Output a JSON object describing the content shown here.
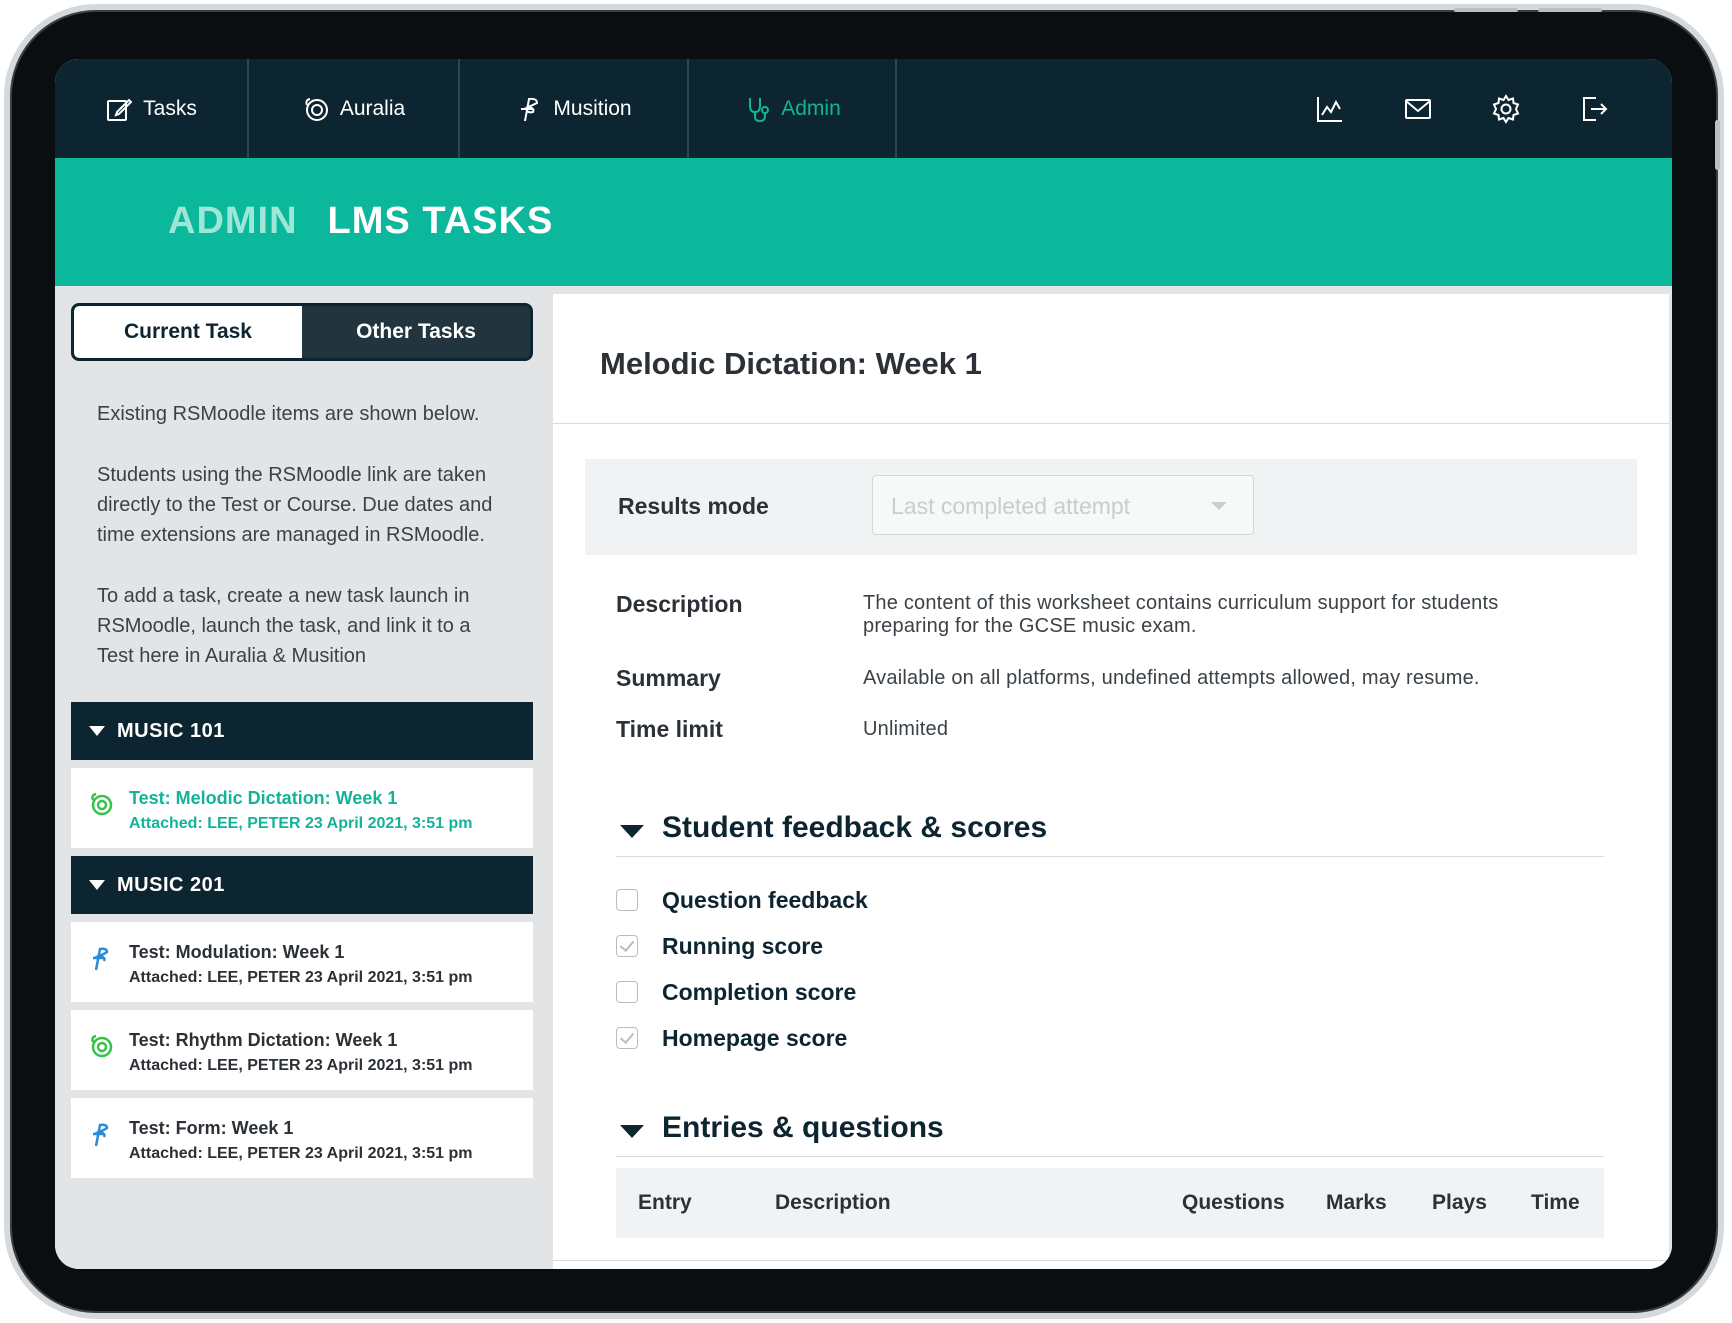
{
  "nav": {
    "items": [
      {
        "label": "Tasks",
        "icon": "edit-icon",
        "active": false
      },
      {
        "label": "Auralia",
        "icon": "auralia-logo-icon",
        "active": false
      },
      {
        "label": "Musition",
        "icon": "musition-logo-icon",
        "active": false
      },
      {
        "label": "Admin",
        "icon": "stethoscope-icon",
        "active": true
      }
    ],
    "right_icons": [
      "chart-icon",
      "mail-icon",
      "gear-icon",
      "logout-icon"
    ]
  },
  "hero": {
    "section": "ADMIN",
    "title": "LMS TASKS"
  },
  "left": {
    "tabs": {
      "current": "Current Task",
      "other": "Other Tasks"
    },
    "info": [
      "Existing RSMoodle items are shown below.",
      "Students using the RSMoodle link are taken directly to the Test or Course. Due dates and time extensions are managed in RSMoodle.",
      "To add a task, create a new task launch in RSMoodle, launch the task, and link it to a Test here in Auralia & Musition"
    ],
    "groups": [
      {
        "name": "MUSIC 101",
        "tasks": [
          {
            "title": "Test: Melodic Dictation: Week 1",
            "attached": "Attached: LEE, PETER 23 April 2021, 3:51 pm",
            "app": "auralia",
            "active": true
          }
        ]
      },
      {
        "name": "MUSIC 201",
        "tasks": [
          {
            "title": "Test: Modulation: Week 1",
            "attached": "Attached: LEE, PETER 23 April 2021, 3:51 pm",
            "app": "musition",
            "active": false
          },
          {
            "title": "Test: Rhythm Dictation: Week 1",
            "attached": "Attached: LEE, PETER 23 April 2021, 3:51 pm",
            "app": "auralia",
            "active": false
          },
          {
            "title": "Test: Form: Week 1",
            "attached": "Attached: LEE, PETER 23 April 2021, 3:51 pm",
            "app": "musition",
            "active": false
          }
        ]
      }
    ]
  },
  "main": {
    "title": "Melodic Dictation: Week 1",
    "results_mode": {
      "label": "Results mode",
      "value": "Last completed attempt"
    },
    "details": [
      {
        "key": "Description",
        "value": "The content of this worksheet contains curriculum support for students preparing for the GCSE music exam."
      },
      {
        "key": "Summary",
        "value": "Available on all platforms, undefined attempts allowed, may resume."
      },
      {
        "key": "Time limit",
        "value": "Unlimited"
      }
    ],
    "feedback": {
      "heading": "Student feedback & scores",
      "options": [
        {
          "label": "Question feedback",
          "checked": false
        },
        {
          "label": "Running score",
          "checked": true
        },
        {
          "label": "Completion score",
          "checked": false
        },
        {
          "label": "Homepage score",
          "checked": true
        }
      ]
    },
    "entries": {
      "heading": "Entries & questions",
      "columns": [
        "Entry",
        "Description",
        "Questions",
        "Marks",
        "Plays",
        "Time"
      ]
    }
  },
  "colors": {
    "navy": "#0d2531",
    "teal": "#0bb89c",
    "accent_green": "#13b398",
    "musition_blue": "#2d8ad6",
    "auralia_green": "#37c24a"
  }
}
